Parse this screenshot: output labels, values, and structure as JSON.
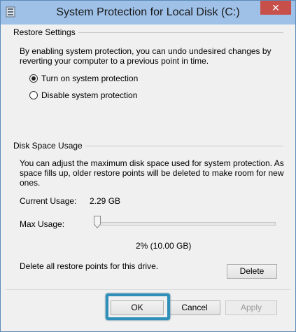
{
  "window": {
    "title": "System Protection for Local Disk (C:)",
    "close_label": "✕",
    "app_icon": "drive-icon"
  },
  "restore_settings": {
    "group_title": "Restore Settings",
    "description_line1": "By enabling system protection, you can undo undesired changes by",
    "description_line2": "reverting your computer to a previous point in time.",
    "radio_on_label": "Turn on system protection",
    "radio_off_label": "Disable system protection",
    "selected": "on"
  },
  "disk_space": {
    "group_title": "Disk Space Usage",
    "description_line1": "You can adjust the maximum disk space used for system protection. As",
    "description_line2": "space fills up, older restore points will be deleted to make room for new",
    "description_line3": "ones.",
    "current_usage_label": "Current Usage:",
    "current_usage_value": "2.29 GB",
    "max_usage_label": "Max Usage:",
    "max_usage_percent": 2,
    "max_usage_value": "2% (10.00 GB)",
    "delete_text": "Delete all restore points for this drive.",
    "delete_button": "Delete"
  },
  "footer": {
    "ok_label": "OK",
    "cancel_label": "Cancel",
    "apply_label": "Apply"
  },
  "colors": {
    "titlebar": "#9fc1e8",
    "close": "#c7504b",
    "highlight": "#2f8fb8"
  }
}
